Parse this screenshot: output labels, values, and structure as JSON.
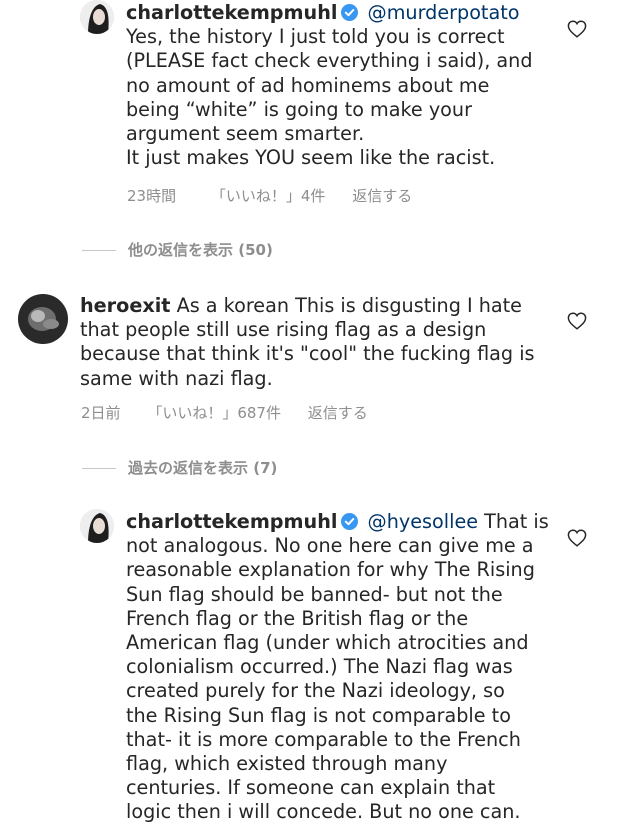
{
  "comments": [
    {
      "username": "charlottekempmuhl",
      "mention": "@murderpotato",
      "body_lines": [
        "Yes, the history I just told you is correct",
        "(PLEASE fact check everything i said), and",
        "no amount of ad  hominems about me",
        "being “white” is going to make your",
        "argument seem smarter.",
        "It just makes YOU seem like the racist."
      ],
      "time": "23時間",
      "likes": "「いいね！」4件",
      "reply": "返信する"
    },
    {
      "username": "heroexit",
      "first_line_rest": "As a korean This is disgusting I hate",
      "body_lines": [
        "that people still use rising flag as a design",
        "because that think it's \"cool\" the fucking flag is",
        "same with nazi flag."
      ],
      "time": "2日前",
      "likes": "「いいね！」687件",
      "reply": "返信する"
    },
    {
      "username": "charlottekempmuhl",
      "mention": "@hyesollee",
      "first_line_rest": "That is",
      "body_lines": [
        "not analogous. No one here can give me a",
        "reasonable explanation for why The Rising",
        "Sun flag should be banned- but not the",
        "French flag or the British flag or the",
        "American flag (under which atrocities and",
        "colonialism occurred.) The Nazi flag was",
        "created purely for the Nazi ideology, so",
        "the Rising Sun flag is not comparable to",
        "that- it is more comparable to the French",
        "flag, which existed through many",
        "centuries. If someone can explain that",
        "logic then i will concede. But no one can."
      ]
    }
  ],
  "more_replies": [
    "他の返信を表示 (50)",
    "過去の返信を表示 (7)"
  ],
  "colors": {
    "text": "#262626",
    "meta": "#8e8e8e",
    "mention": "#003569",
    "verified": "#3897f0"
  }
}
